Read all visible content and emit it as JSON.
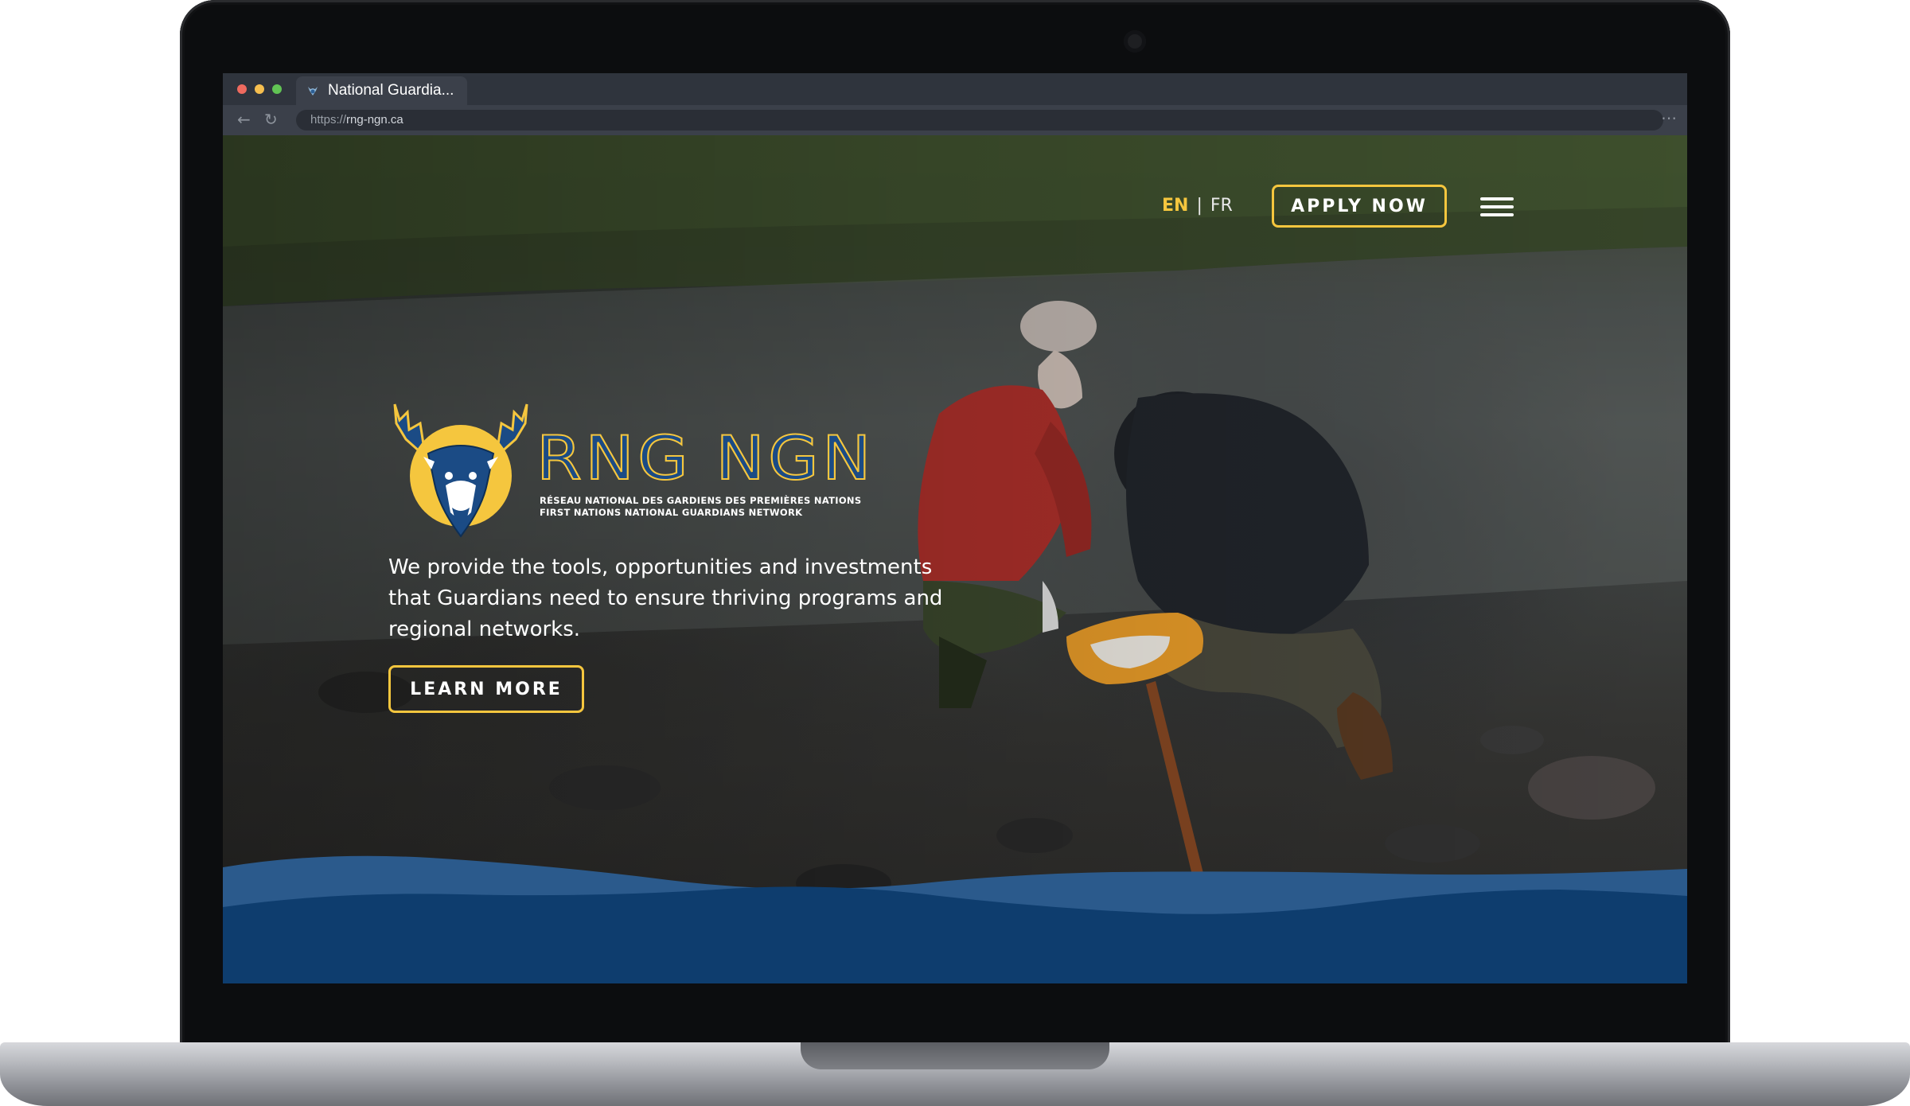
{
  "browser": {
    "tab_title": "National Guardia...",
    "url_scheme": "https://",
    "url_host": "rng-ngn.ca",
    "back_icon": "arrow-left-icon",
    "reload_icon": "reload-icon",
    "more_icon": "more-dots-icon"
  },
  "header": {
    "lang_en": "EN",
    "lang_separator": "|",
    "lang_fr": "FR",
    "apply_label": "APPLY NOW",
    "menu_icon": "hamburger-menu-icon"
  },
  "logo": {
    "wordmark": "RNG NGN",
    "subtitle_fr": "RÉSEAU NATIONAL DES GARDIENS DES PREMIÈRES NATIONS",
    "subtitle_en": "FIRST NATIONS NATIONAL GUARDIANS NETWORK"
  },
  "hero": {
    "text": "We provide the tools, opportunities and investments that Guardians need to ensure thriving programs and regional networks.",
    "learn_more_label": "LEARN MORE"
  },
  "colors": {
    "accent_yellow": "#f5c63e",
    "brand_blue": "#1b4b85",
    "wave_dark": "#0e3d6e",
    "wave_light": "#2b5a8c"
  }
}
